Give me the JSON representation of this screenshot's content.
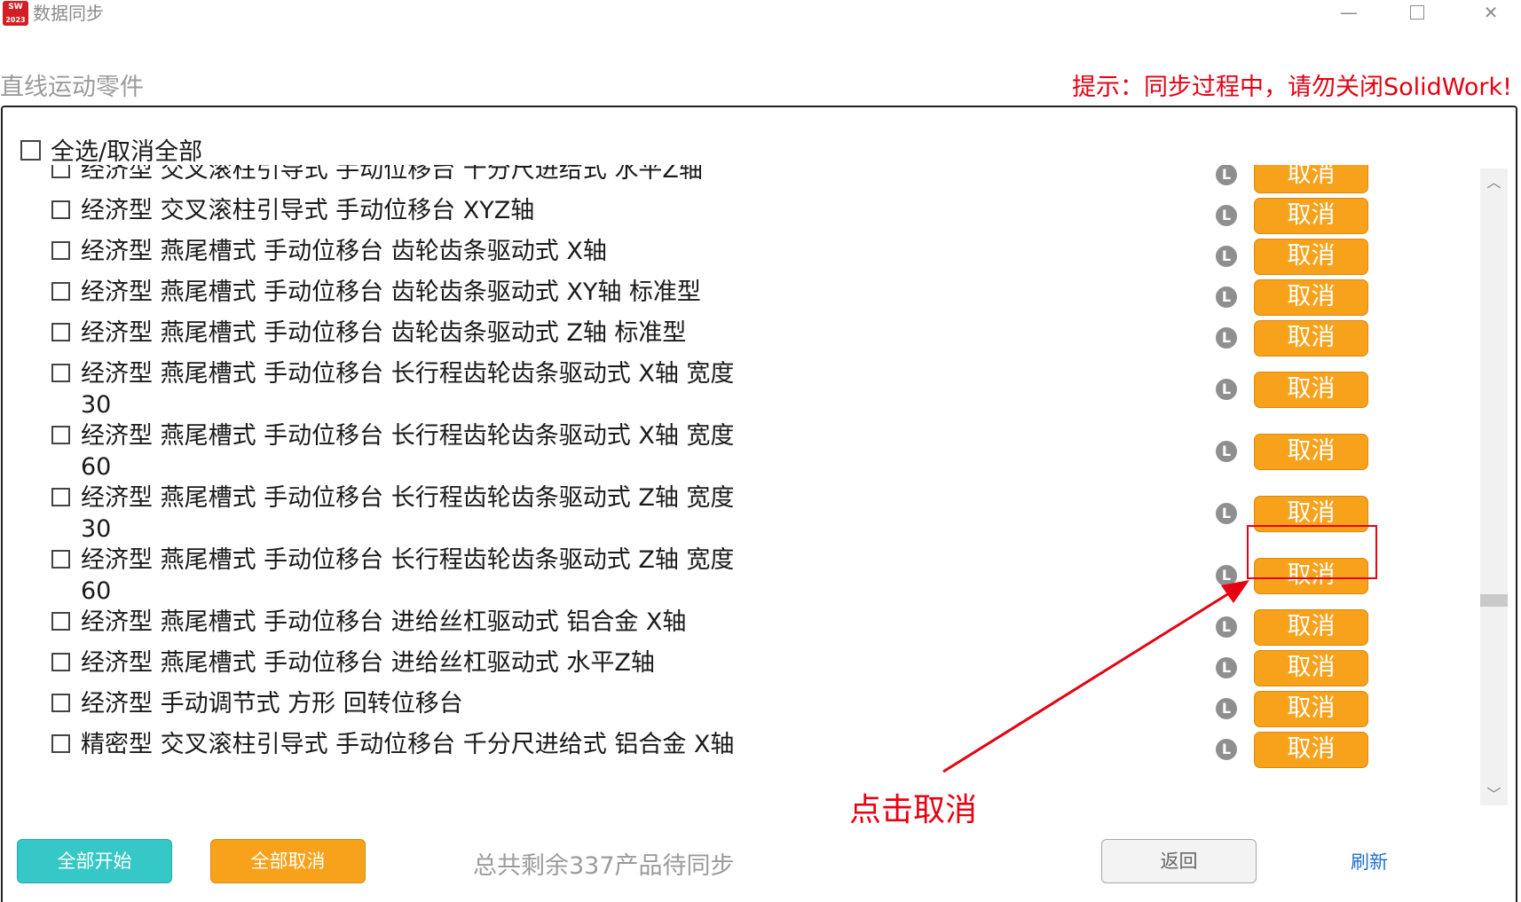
{
  "window": {
    "title": "数据同步",
    "logo_text": "SW",
    "logo_year": "2023",
    "minimize": "—",
    "close": "✕"
  },
  "header": {
    "category": "直线运动零件",
    "hint": "提示：同步过程中，请勿关闭SolidWork!"
  },
  "select_all_label": "全选/取消全部",
  "row_icon_letter": "L",
  "cancel_label": "取消",
  "items": [
    {
      "line1": "经济型 交叉滚柱引导式 手动位移台 千分尺进给式 水平Z轴",
      "line2": ""
    },
    {
      "line1": "经济型 交叉滚柱引导式 手动位移台 XYZ轴",
      "line2": ""
    },
    {
      "line1": "经济型 燕尾槽式 手动位移台 齿轮齿条驱动式 X轴",
      "line2": ""
    },
    {
      "line1": "经济型 燕尾槽式 手动位移台 齿轮齿条驱动式 XY轴 标准型",
      "line2": ""
    },
    {
      "line1": "经济型 燕尾槽式 手动位移台 齿轮齿条驱动式 Z轴 标准型",
      "line2": ""
    },
    {
      "line1": "经济型 燕尾槽式 手动位移台 长行程齿轮齿条驱动式 X轴 宽度",
      "line2": "30"
    },
    {
      "line1": "经济型 燕尾槽式 手动位移台 长行程齿轮齿条驱动式 X轴 宽度",
      "line2": "60"
    },
    {
      "line1": "经济型 燕尾槽式 手动位移台 长行程齿轮齿条驱动式 Z轴 宽度",
      "line2": "30"
    },
    {
      "line1": "经济型 燕尾槽式 手动位移台 长行程齿轮齿条驱动式 Z轴 宽度",
      "line2": "60"
    },
    {
      "line1": "经济型 燕尾槽式 手动位移台 进给丝杠驱动式 铝合金 X轴",
      "line2": ""
    },
    {
      "line1": "经济型 燕尾槽式 手动位移台 进给丝杠驱动式 水平Z轴",
      "line2": ""
    },
    {
      "line1": "经济型 手动调节式 方形 回转位移台",
      "line2": ""
    },
    {
      "line1": "精密型 交叉滚柱引导式 手动位移台 千分尺进给式 铝合金 X轴",
      "line2": ""
    }
  ],
  "annotation": "点击取消",
  "footer": {
    "start_all": "全部开始",
    "cancel_all": "全部取消",
    "remaining": "总共剩余337产品待同步",
    "back": "返回",
    "refresh": "刷新"
  },
  "colors": {
    "cancel_button": "#f8a21b",
    "start_button": "#35c8c6",
    "hint_red": "#e60012",
    "refresh_link": "#1f6fd0"
  }
}
